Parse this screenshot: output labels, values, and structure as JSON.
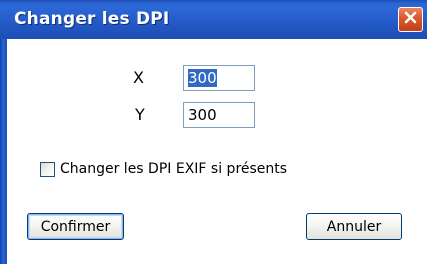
{
  "window": {
    "title": "Changer les DPI"
  },
  "fields": {
    "x_label": "X",
    "x_value": "300",
    "y_label": "Y",
    "y_value": "300"
  },
  "options": {
    "exif_label": "Changer les DPI EXIF si présents",
    "exif_checked": false
  },
  "buttons": {
    "confirm_label": "Confirmer",
    "cancel_label": "Annuler"
  },
  "icons": {
    "close": "close-icon"
  },
  "colors": {
    "titlebar": "#2359c6",
    "close_button": "#d8572d",
    "selection": "#316ac5"
  }
}
